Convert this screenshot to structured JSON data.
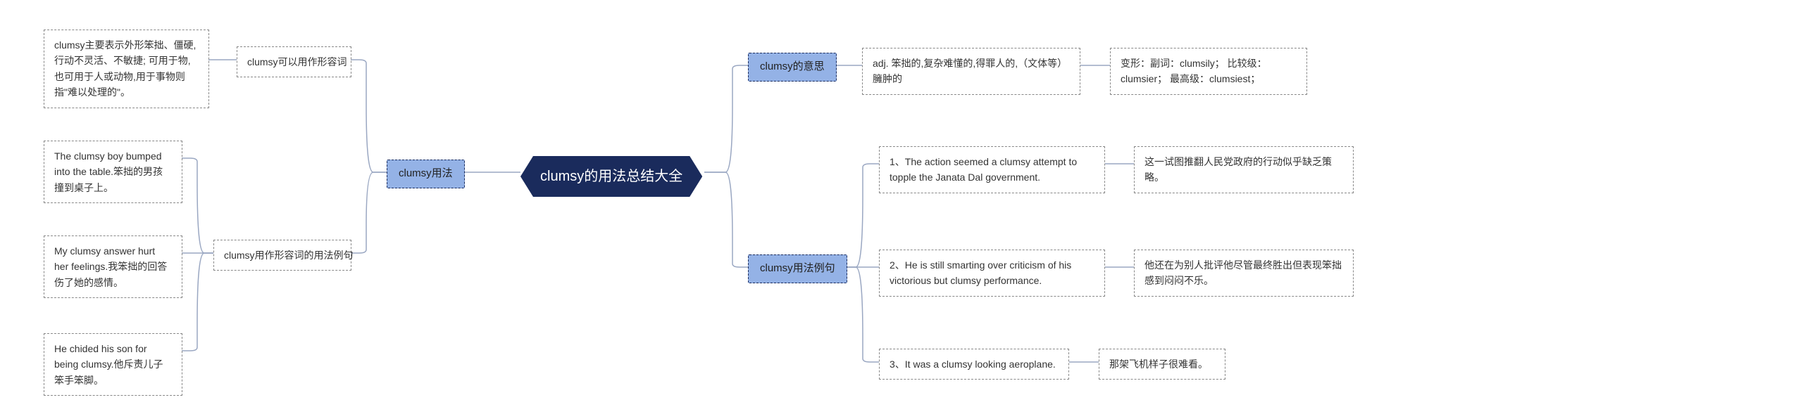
{
  "root": {
    "title": "clumsy的用法总结大全"
  },
  "left": {
    "branch": {
      "label": "clumsy用法"
    },
    "sub1": {
      "label": "clumsy可以用作形容词",
      "leaf": "clumsy主要表示外形笨拙、僵硬,行动不灵活、不敏捷; 可用于物,也可用于人或动物,用于事物则指\"难以处理的\"。"
    },
    "sub2": {
      "label": "clumsy用作形容词的用法例句",
      "leaves": {
        "a": "The clumsy boy bumped into the table.笨拙的男孩撞到桌子上。",
        "b": "My clumsy answer hurt her feelings.我笨拙的回答伤了她的感情。",
        "c": "He chided his son for being clumsy.他斥责儿子笨手笨脚。"
      }
    }
  },
  "right": {
    "branch1": {
      "label": "clumsy的意思",
      "leaf1": "adj. 笨拙的,复杂难懂的,得罪人的,（文体等）臃肿的",
      "leaf2": "变形：副词：clumsily；  比较级：clumsier；  最高级：clumsiest；"
    },
    "branch2": {
      "label": "clumsy用法例句",
      "rows": {
        "r1": {
          "en": "1、The action seemed a clumsy attempt to topple the Janata Dal government.",
          "zh": "这一试图推翻人民党政府的行动似乎缺乏策略。"
        },
        "r2": {
          "en": "2、He is still smarting over criticism of his victorious but clumsy performance.",
          "zh": "他还在为别人批评他尽管最终胜出但表现笨拙感到闷闷不乐。"
        },
        "r3": {
          "en": "3、It was a clumsy looking aeroplane.",
          "zh": "那架飞机样子很难看。"
        }
      }
    }
  }
}
